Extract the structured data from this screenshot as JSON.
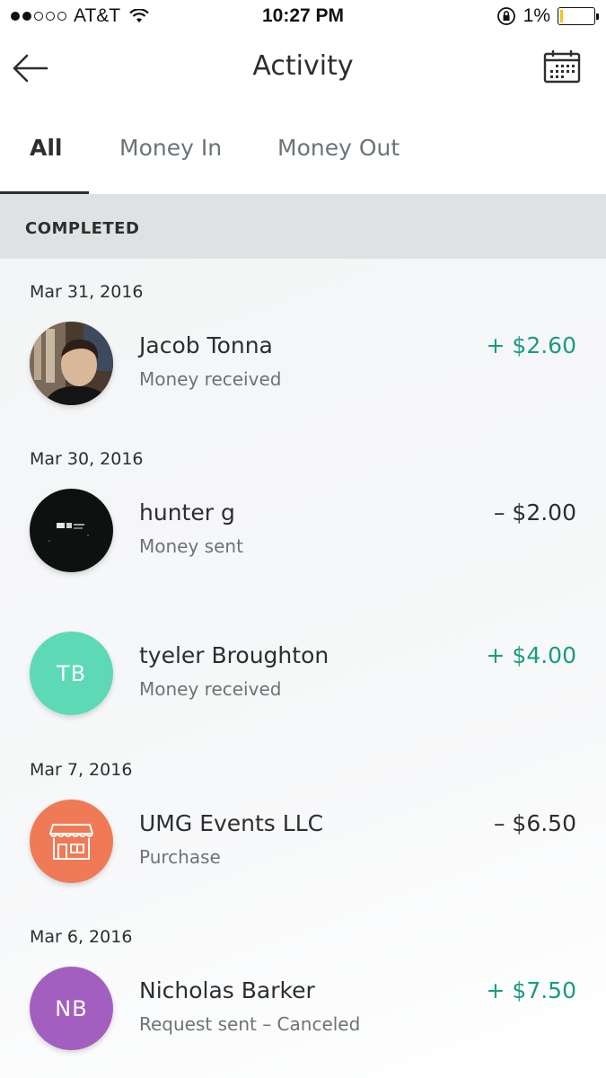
{
  "status_bar": {
    "carrier": "AT&T",
    "time": "10:27 PM",
    "battery": "1%"
  },
  "header": {
    "title": "Activity",
    "back_icon": "arrow-left-icon",
    "calendar_icon": "calendar-icon"
  },
  "tabs": [
    {
      "label": "All",
      "active": true
    },
    {
      "label": "Money In",
      "active": false
    },
    {
      "label": "Money Out",
      "active": false
    }
  ],
  "section": {
    "label": "COMPLETED"
  },
  "dates": [
    "Mar 31, 2016",
    "Mar 30, 2016",
    "Mar 7, 2016",
    "Mar 6, 2016"
  ],
  "transactions": [
    {
      "name": "Jacob Tonna",
      "status": "Money received",
      "amount": "+ $2.60",
      "direction": "in",
      "avatar": "photo"
    },
    {
      "name": "hunter g",
      "status": "Money sent",
      "amount": "– $2.00",
      "direction": "out",
      "avatar": "photo-dark"
    },
    {
      "name": "tyeler Broughton",
      "status": "Money received",
      "amount": "+ $4.00",
      "direction": "in",
      "avatar": "initials",
      "initials": "TB",
      "color": "#5ed9b5"
    },
    {
      "name": "UMG Events LLC",
      "status": "Purchase",
      "amount": "– $6.50",
      "direction": "out",
      "avatar": "store-icon",
      "color": "#f07a55"
    },
    {
      "name": "Nicholas Barker",
      "status": "Request sent – Canceled",
      "amount": "+ $7.50",
      "direction": "in",
      "avatar": "initials",
      "initials": "NB",
      "color": "#a35fc0"
    }
  ],
  "colors": {
    "money_in": "#1a9b82",
    "section_bg": "#dfe1e3"
  }
}
